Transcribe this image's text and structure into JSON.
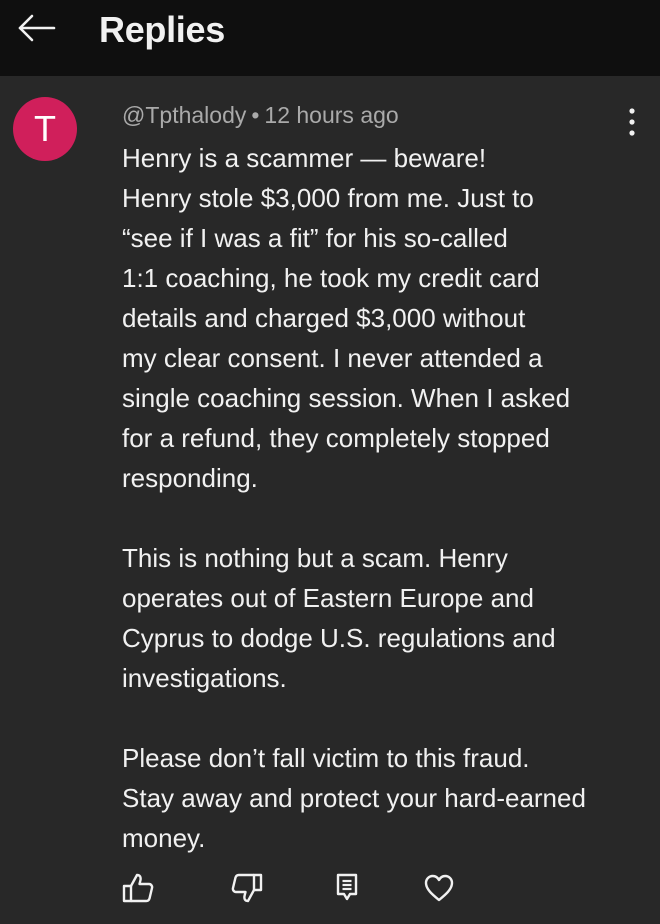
{
  "header": {
    "back_icon": "arrow-left-icon",
    "title": "Replies"
  },
  "comment": {
    "avatar_letter": "T",
    "avatar_color": "#d01f5b",
    "author": "@Tpthalody",
    "separator": "•",
    "time": "12 hours ago",
    "more_icon": "vertical-dots-icon",
    "paragraphs": [
      {
        "lines": [
          "Henry is a scammer — beware!",
          "Henry stole $3,000 from me. Just to",
          "“see if I was a fit” for his so-called",
          "1:1 coaching, he took my credit card",
          "details and charged $3,000 without",
          "my clear consent. I never attended a",
          "single coaching session. When I asked",
          "for a refund, they completely stopped",
          "responding."
        ]
      },
      {
        "lines": [
          "This is nothing but a scam. Henry",
          "operates out of Eastern Europe and",
          "Cyprus to dodge U.S. regulations and",
          "investigations."
        ]
      },
      {
        "lines": [
          "Please don’t fall victim to this fraud.",
          "Stay away and protect your hard-earned",
          "money."
        ]
      }
    ]
  },
  "actions": [
    {
      "name": "like-button",
      "icon": "thumbs-up-icon"
    },
    {
      "name": "dislike-button",
      "icon": "thumbs-down-icon"
    },
    {
      "name": "reply-button",
      "icon": "comment-icon"
    },
    {
      "name": "heart-button",
      "icon": "heart-icon"
    }
  ],
  "colors": {
    "background": "#282828",
    "header_background": "#0f0f0f",
    "text": "#f1f1f1",
    "meta_text": "#aaaaaa"
  }
}
